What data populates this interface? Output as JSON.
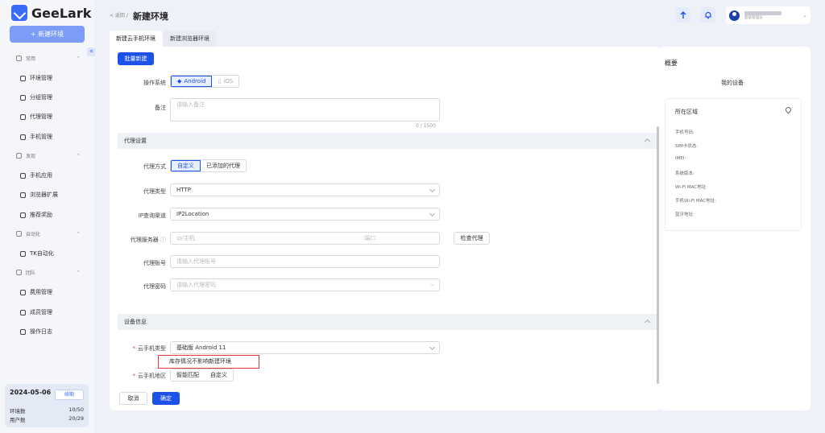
{
  "app": {
    "name": "GeeLark"
  },
  "sidebar": {
    "new_env_label": "+ 新建环境",
    "groups": [
      {
        "label": "常用",
        "items": [
          "环境管理",
          "分组管理",
          "代理管理",
          "手机管理"
        ]
      },
      {
        "label": "发现",
        "items": [
          "手机应用",
          "浏览器扩展",
          "推荐奖励"
        ]
      },
      {
        "label": "自动化",
        "items": [
          "TK自动化"
        ]
      },
      {
        "label": "团队",
        "items": [
          "费用管理",
          "成员管理",
          "操作日志"
        ]
      }
    ],
    "date": "2024-05-06",
    "renew_label": "续期",
    "env_count_label": "环境数",
    "env_count": "10/50",
    "user_count_label": "用户数",
    "user_count": "20/29"
  },
  "header": {
    "breadcrumb": "< 返回 /",
    "title": "新建环境",
    "user_sub": "超级管理员"
  },
  "tabs": [
    "新建云手机环境",
    "新建浏览器环境"
  ],
  "form": {
    "batch_label": "批量新建",
    "os_label": "操作系统",
    "os_options": [
      "Android",
      "iOS"
    ],
    "note_label": "备注",
    "note_placeholder": "请输入备注",
    "note_counter": "0 / 1500",
    "proxy_section": "代理设置",
    "proxy_mode_label": "代理方式",
    "proxy_mode_options": [
      "自定义",
      "已添加的代理"
    ],
    "proxy_type_label": "代理类型",
    "proxy_type_value": "HTTP",
    "ip_channel_label": "IP查询渠道",
    "ip_channel_value": "IP2Location",
    "proxy_server_label": "代理服务器",
    "proxy_host_placeholder": "ip/主机",
    "proxy_port_placeholder": ":端口",
    "check_proxy_label": "检查代理",
    "proxy_account_label": "代理账号",
    "proxy_account_placeholder": "请输入代理账号",
    "proxy_password_label": "代理密码",
    "proxy_password_placeholder": "请输入代理密码",
    "device_section": "设备信息",
    "phone_type_label": "云手机类型",
    "phone_type_value": "基础版 Android 11",
    "stock_tip": "库存情况不影响新建环境",
    "region_label": "云手机地区",
    "region_options": [
      "智能匹配",
      "自定义"
    ],
    "cancel_label": "取消",
    "confirm_label": "确定"
  },
  "summary": {
    "title": "概要",
    "device_label": "我的设备",
    "region_label": "所在区域",
    "rows": [
      "手机号码:",
      "SIM卡状态:",
      "IMEI:",
      "系统版本:",
      "Wi-Fi MAC地址:",
      "手机Wi-Fi MAC地址:",
      "蓝牙地址:"
    ]
  }
}
